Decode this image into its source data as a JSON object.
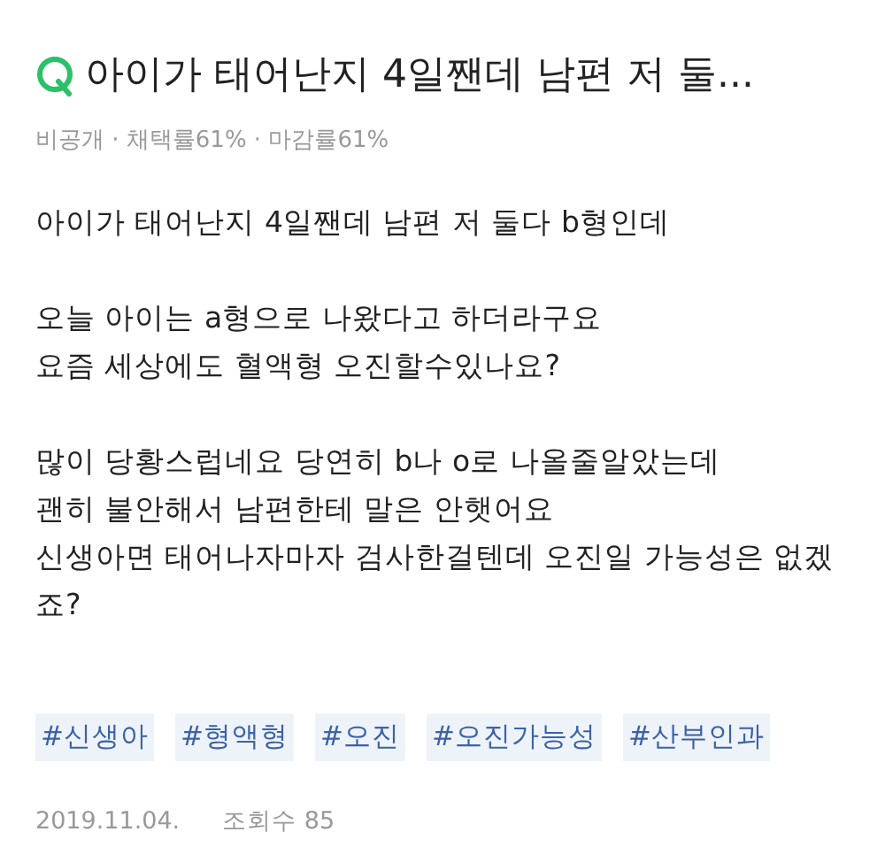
{
  "question": {
    "title": "아이가 태어난지 4일짼데 남편 저 둘...",
    "meta": "비공개 · 채택률61% · 마감률61%"
  },
  "body": [
    [
      "아이가 태어난지 4일짼데 남편 저 둘다 b형인데"
    ],
    [
      "오늘 아이는 a형으로 나왔다고 하더라구요",
      "요즘 세상에도 혈액형 오진할수있나요?"
    ],
    [
      "많이 당황스럽네요 당연히 b나 o로 나올줄알았는데",
      "괜히 불안해서 남편한테 말은 안햇어요",
      "신생아면 태어나자마자 검사한걸텐데 오진일 가능성은 없겠",
      "죠?"
    ]
  ],
  "tags": [
    "#신생아",
    "#형액형",
    "#오진",
    "#오진가능성",
    "#산부인과"
  ],
  "footer": {
    "date": "2019.11.04.",
    "views": "조회수 85"
  }
}
